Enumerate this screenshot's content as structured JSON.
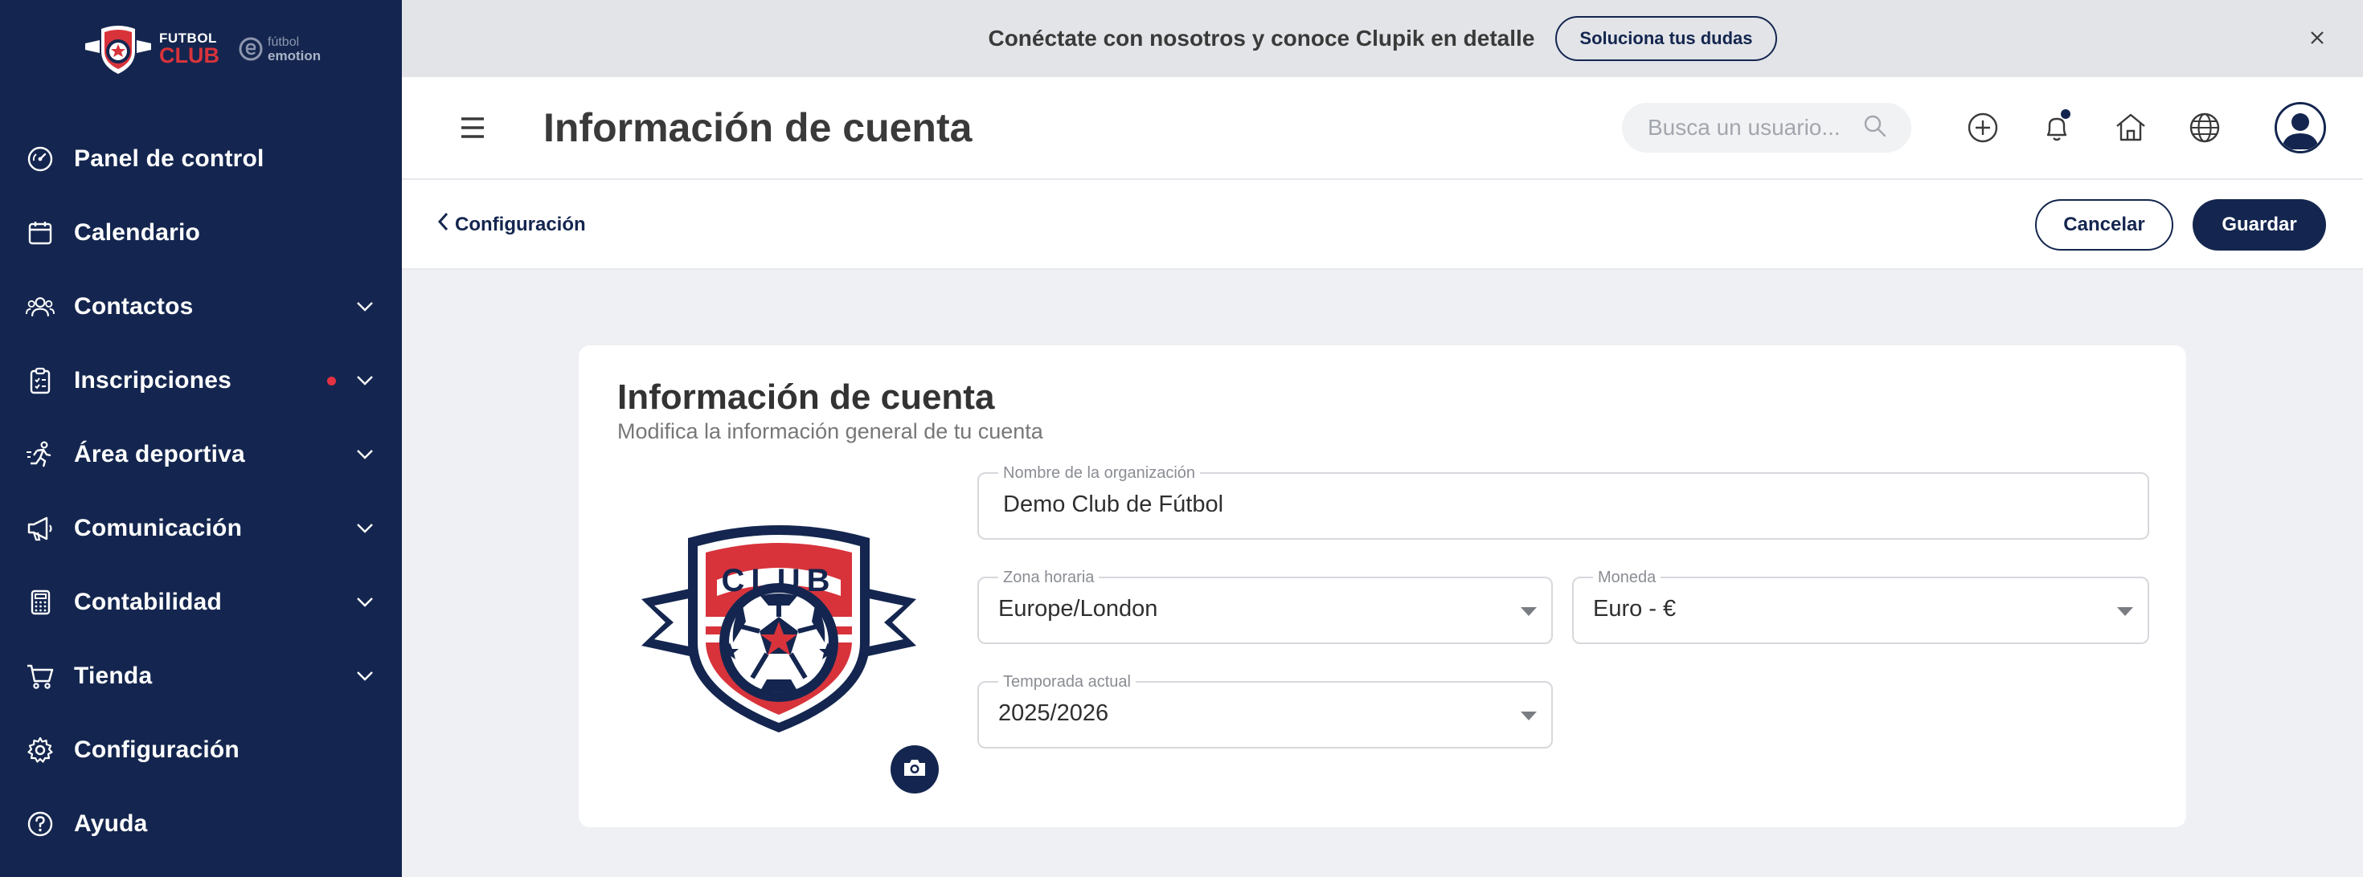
{
  "sidebar": {
    "logo": {
      "line1": "FUTBOL",
      "line2": "CLUB",
      "partner_line1": "fútbol",
      "partner_line2": "emotion"
    },
    "items": [
      {
        "label": "Panel de control",
        "icon": "dashboard-icon",
        "has_chevron": false,
        "has_dot": false
      },
      {
        "label": "Calendario",
        "icon": "calendar-icon",
        "has_chevron": false,
        "has_dot": false
      },
      {
        "label": "Contactos",
        "icon": "contacts-icon",
        "has_chevron": true,
        "has_dot": false
      },
      {
        "label": "Inscripciones",
        "icon": "clipboard-icon",
        "has_chevron": true,
        "has_dot": true
      },
      {
        "label": "Área deportiva",
        "icon": "runner-icon",
        "has_chevron": true,
        "has_dot": false
      },
      {
        "label": "Comunicación",
        "icon": "megaphone-icon",
        "has_chevron": true,
        "has_dot": false
      },
      {
        "label": "Contabilidad",
        "icon": "calculator-icon",
        "has_chevron": true,
        "has_dot": false
      },
      {
        "label": "Tienda",
        "icon": "cart-icon",
        "has_chevron": true,
        "has_dot": false
      },
      {
        "label": "Configuración",
        "icon": "gear-icon",
        "has_chevron": false,
        "has_dot": false
      },
      {
        "label": "Ayuda",
        "icon": "help-icon",
        "has_chevron": false,
        "has_dot": false
      }
    ]
  },
  "banner": {
    "text": "Conéctate con nosotros y conoce Clupik en detalle",
    "button": "Soluciona tus dudas"
  },
  "header": {
    "title": "Información de cuenta",
    "search_placeholder": "Busca un usuario..."
  },
  "subheader": {
    "back_label": "Configuración",
    "cancel_label": "Cancelar",
    "save_label": "Guardar"
  },
  "card": {
    "title": "Información de cuenta",
    "subtitle": "Modifica la información general de tu cuenta",
    "crest_text": "CLUB",
    "fields": {
      "org_name": {
        "label": "Nombre de la organización",
        "value": "Demo Club de Fútbol"
      },
      "timezone": {
        "label": "Zona horaria",
        "value": "Europe/London"
      },
      "currency": {
        "label": "Moneda",
        "value": "Euro - €"
      },
      "season": {
        "label": "Temporada actual",
        "value": "2025/2026"
      }
    }
  },
  "colors": {
    "navy": "#14264f",
    "red": "#d8333b",
    "background": "#eef0f4"
  }
}
